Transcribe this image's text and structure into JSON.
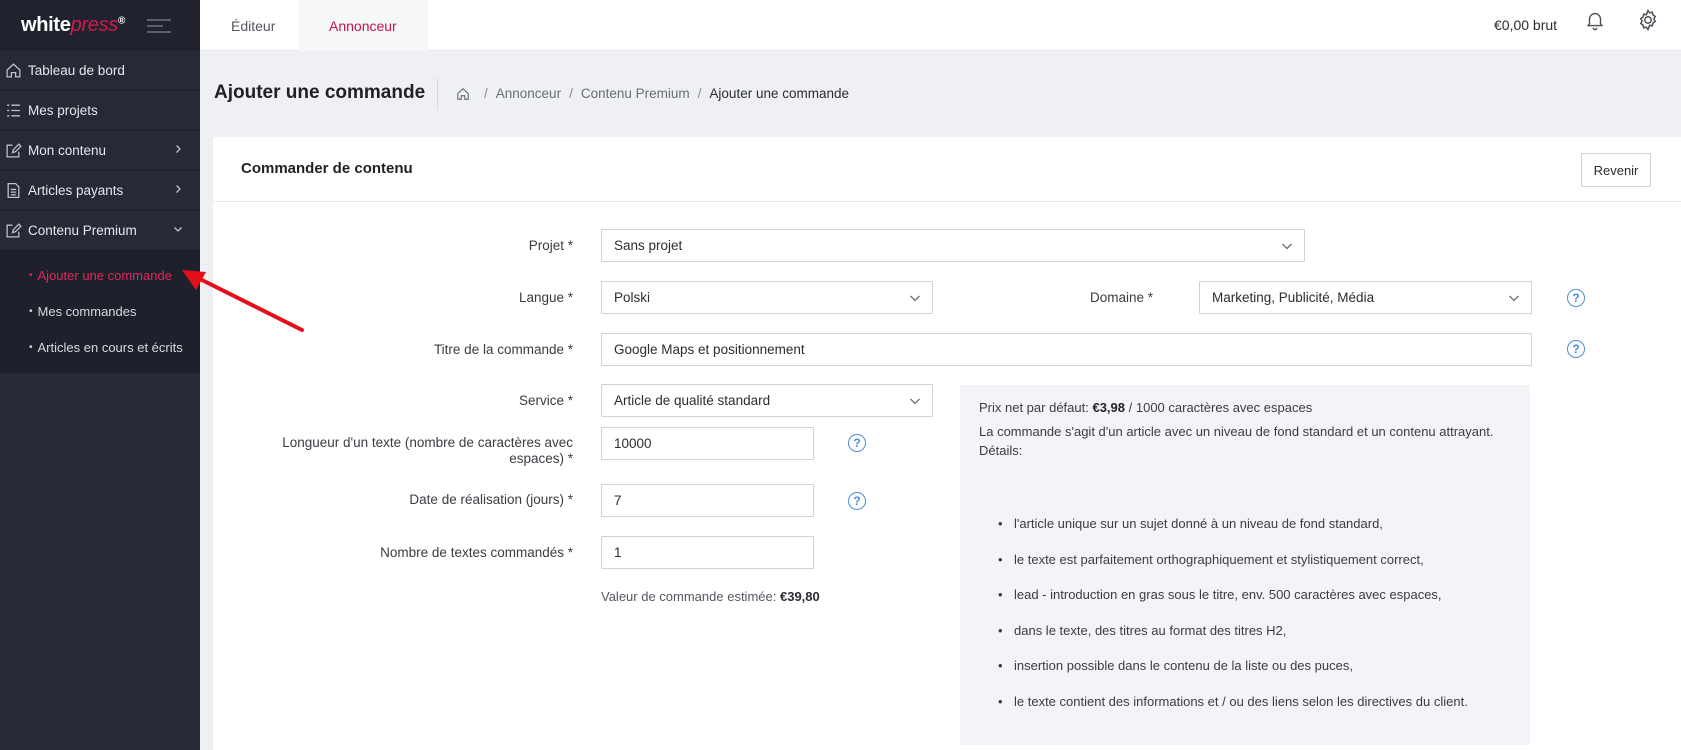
{
  "logo": {
    "part1": "white",
    "part2": "press",
    "mark": "®"
  },
  "sidebar": {
    "items": [
      {
        "label": "Tableau de bord",
        "icon": "home-icon"
      },
      {
        "label": "Mes projets",
        "icon": "list-icon"
      },
      {
        "label": "Mon contenu",
        "icon": "edit-icon"
      },
      {
        "label": "Articles payants",
        "icon": "document-icon"
      },
      {
        "label": "Contenu Premium",
        "icon": "edit-icon"
      }
    ],
    "submenu": [
      {
        "label": "Ajouter une commande",
        "active": true
      },
      {
        "label": "Mes commandes"
      },
      {
        "label": "Articles en cours et écrits"
      }
    ]
  },
  "topbar": {
    "tabs": [
      "Éditeur",
      "Annonceur"
    ],
    "active_tab": "Annonceur",
    "price": "€0,00 brut"
  },
  "header": {
    "title": "Ajouter une commande",
    "breadcrumb": [
      "Annonceur",
      "Contenu Premium",
      "Ajouter une commande"
    ]
  },
  "card": {
    "title": "Commander de contenu",
    "back_button": "Revenir"
  },
  "form": {
    "projet_label": "Projet *",
    "projet_value": "Sans projet",
    "langue_label": "Langue *",
    "langue_value": "Polski",
    "domaine_label": "Domaine *",
    "domaine_value": "Marketing, Publicité, Média",
    "titre_label": "Titre de la commande *",
    "titre_value": "Google Maps et positionnement",
    "service_label": "Service *",
    "service_value": "Article de qualité standard",
    "longueur_label_1": "Longueur d'un texte (nombre de caractères avec",
    "longueur_label_2": "espaces) *",
    "longueur_value": "10000",
    "date_label": "Date de réalisation (jours) *",
    "date_value": "7",
    "nombre_label": "Nombre de textes commandés *",
    "nombre_value": "1",
    "estimate_label": "Valeur de commande estimée:",
    "estimate_value": "€39,80"
  },
  "info": {
    "price_prefix": "Prix net par défaut:",
    "price_value": "€3,98",
    "price_suffix": "/ 1000 caractères avec espaces",
    "description": "La commande s'agit d'un article avec un niveau de fond standard et un contenu attrayant.",
    "details_label": "Détails:",
    "bullets": [
      "l'article unique sur un sujet donné à un niveau de fond standard,",
      "le texte est parfaitement orthographiquement et stylistiquement correct,",
      "lead - introduction en gras sous le titre, env. 500 caractères avec espaces,",
      "dans le texte, des titres au format des titres H2,",
      "insertion possible dans le contenu de la liste ou des puces,",
      "le texte contient des informations et / ou des liens selon les directives du client."
    ]
  },
  "colors": {
    "sidebar_bg": "#262936",
    "accent": "#c0174b",
    "help_blue": "#4c8fd6",
    "arrow_red": "#e3101b"
  }
}
